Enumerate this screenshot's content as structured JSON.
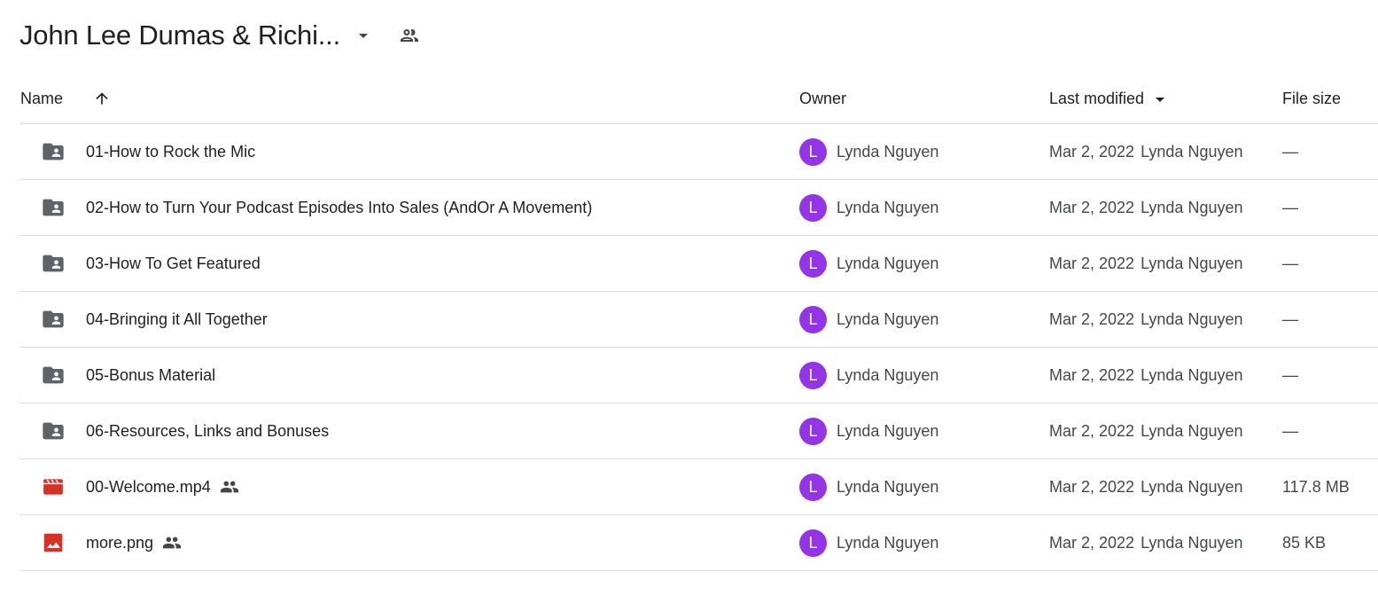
{
  "folder": {
    "title": "John Lee Dumas & Richi...",
    "caret_icon": "arrow-drop-down-icon",
    "shared_icon": "people-icon"
  },
  "columns": {
    "name": "Name",
    "owner": "Owner",
    "last_modified": "Last modified",
    "file_size": "File size",
    "sort_direction": "ascending"
  },
  "colors": {
    "avatar": "#9334e6",
    "folder_icon": "#5f6368",
    "video_icon": "#d93025",
    "image_icon": "#d93025",
    "divider": "#dadce0"
  },
  "rows": [
    {
      "name": "01-How to Rock the Mic",
      "type": "shared-folder",
      "icon": "shared-folder-icon",
      "shared": false,
      "owner_initial": "L",
      "owner": "Lynda Nguyen",
      "modified_date": "Mar 2, 2022",
      "modified_by": "Lynda Nguyen",
      "size": "—"
    },
    {
      "name": "02-How to Turn Your Podcast Episodes Into Sales (AndOr A Movement)",
      "type": "shared-folder",
      "icon": "shared-folder-icon",
      "shared": false,
      "owner_initial": "L",
      "owner": "Lynda Nguyen",
      "modified_date": "Mar 2, 2022",
      "modified_by": "Lynda Nguyen",
      "size": "—"
    },
    {
      "name": "03-How To Get Featured",
      "type": "shared-folder",
      "icon": "shared-folder-icon",
      "shared": false,
      "owner_initial": "L",
      "owner": "Lynda Nguyen",
      "modified_date": "Mar 2, 2022",
      "modified_by": "Lynda Nguyen",
      "size": "—"
    },
    {
      "name": "04-Bringing it All Together",
      "type": "shared-folder",
      "icon": "shared-folder-icon",
      "shared": false,
      "owner_initial": "L",
      "owner": "Lynda Nguyen",
      "modified_date": "Mar 2, 2022",
      "modified_by": "Lynda Nguyen",
      "size": "—"
    },
    {
      "name": "05-Bonus Material",
      "type": "shared-folder",
      "icon": "shared-folder-icon",
      "shared": false,
      "owner_initial": "L",
      "owner": "Lynda Nguyen",
      "modified_date": "Mar 2, 2022",
      "modified_by": "Lynda Nguyen",
      "size": "—"
    },
    {
      "name": "06-Resources, Links and Bonuses",
      "type": "shared-folder",
      "icon": "shared-folder-icon",
      "shared": false,
      "owner_initial": "L",
      "owner": "Lynda Nguyen",
      "modified_date": "Mar 2, 2022",
      "modified_by": "Lynda Nguyen",
      "size": "—"
    },
    {
      "name": "00-Welcome.mp4",
      "type": "video",
      "icon": "video-file-icon",
      "shared": true,
      "owner_initial": "L",
      "owner": "Lynda Nguyen",
      "modified_date": "Mar 2, 2022",
      "modified_by": "Lynda Nguyen",
      "size": "117.8 MB"
    },
    {
      "name": "more.png",
      "type": "image",
      "icon": "image-file-icon",
      "shared": true,
      "owner_initial": "L",
      "owner": "Lynda Nguyen",
      "modified_date": "Mar 2, 2022",
      "modified_by": "Lynda Nguyen",
      "size": "85 KB"
    }
  ]
}
